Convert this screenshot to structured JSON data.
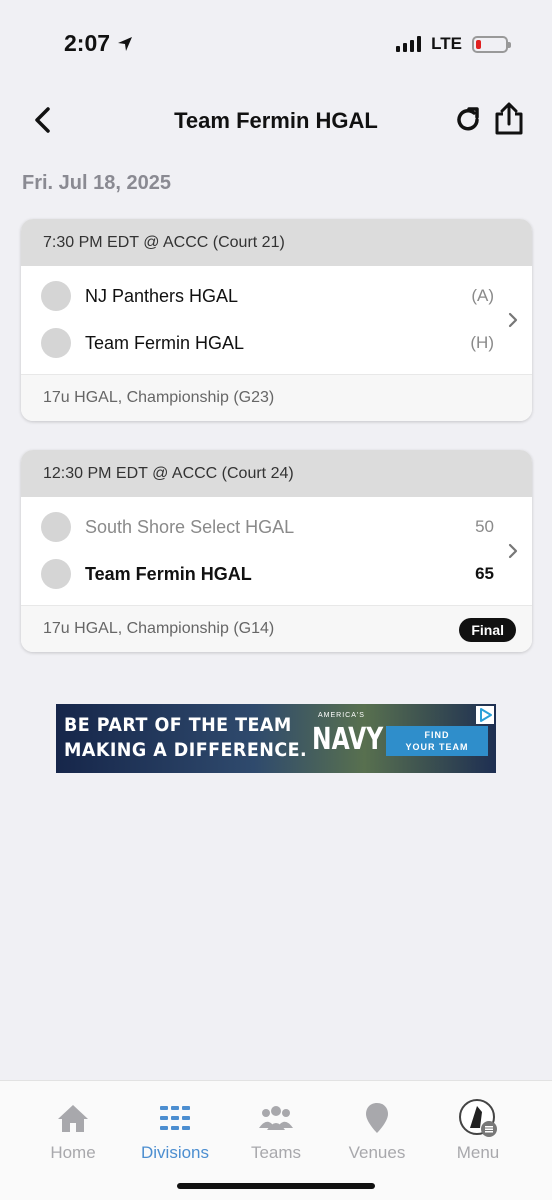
{
  "status_bar": {
    "time": "2:07",
    "network": "LTE"
  },
  "nav": {
    "title": "Team Fermin HGAL"
  },
  "date_heading": "Fri. Jul 18, 2025",
  "games": [
    {
      "header": "7:30 PM EDT @ ACCC (Court 21)",
      "teams": [
        {
          "name": "NJ Panthers HGAL",
          "side": "(A)"
        },
        {
          "name": "Team Fermin HGAL",
          "side": "(H)"
        }
      ],
      "footer": "17u HGAL, Championship (G23)"
    },
    {
      "header": "12:30 PM EDT @ ACCC (Court 24)",
      "teams": [
        {
          "name": "South Shore Select HGAL",
          "score": "50"
        },
        {
          "name": "Team Fermin HGAL",
          "score": "65"
        }
      ],
      "footer": "17u HGAL, Championship (G14)",
      "status": "Final"
    }
  ],
  "ad": {
    "line1": "BE PART OF THE TEAM",
    "line2": "MAKING A DIFFERENCE.",
    "brand_small": "AMERICA'S",
    "brand": "NAVY",
    "cta_line1": "FIND",
    "cta_line2": "YOUR TEAM"
  },
  "tabs": [
    {
      "label": "Home",
      "icon": "home-icon"
    },
    {
      "label": "Divisions",
      "icon": "divisions-icon",
      "active": true
    },
    {
      "label": "Teams",
      "icon": "teams-icon"
    },
    {
      "label": "Venues",
      "icon": "venues-icon"
    },
    {
      "label": "Menu",
      "icon": "menu-avatar-icon"
    }
  ],
  "colors": {
    "accent": "#4c8ed0",
    "inactive": "#a8a8ac",
    "card_header": "#dcdcdc",
    "background": "#f0f0f4"
  }
}
